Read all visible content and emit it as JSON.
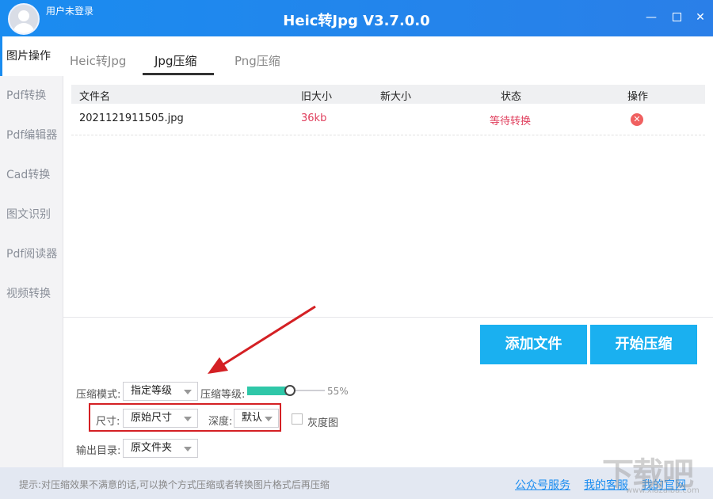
{
  "window": {
    "title": "Heic转Jpg V3.7.0.0",
    "user_label": "用户未登录",
    "minimize": "—",
    "close": "✕"
  },
  "sidebar": {
    "items": [
      {
        "label": "图片操作",
        "active": true
      },
      {
        "label": "Pdf转换"
      },
      {
        "label": "Pdf编辑器"
      },
      {
        "label": "Cad转换"
      },
      {
        "label": "图文识别"
      },
      {
        "label": "Pdf阅读器"
      },
      {
        "label": "视频转换"
      }
    ]
  },
  "tabs": [
    {
      "label": "Heic转Jpg"
    },
    {
      "label": "Jpg压缩",
      "active": true
    },
    {
      "label": "Png压缩"
    }
  ],
  "table": {
    "headers": [
      "文件名",
      "旧大小",
      "新大小",
      "状态",
      "操作"
    ],
    "rows": [
      {
        "filename": "2021121911505.jpg",
        "old_size": "36kb",
        "new_size": "",
        "status": "等待转换",
        "action_icon": "delete-icon"
      }
    ]
  },
  "buttons": {
    "add_files": "添加文件",
    "start_compress": "开始压缩"
  },
  "settings": {
    "mode_label": "压缩模式:",
    "mode_value": "指定等级",
    "level_label": "压缩等级:",
    "level_value": "55%",
    "level_fraction": 0.55,
    "size_label": "尺寸:",
    "size_value": "原始尺寸",
    "depth_label": "深度:",
    "depth_value": "默认",
    "grayscale_label": "灰度图",
    "output_label": "输出目录:",
    "output_value": "原文件夹"
  },
  "footer": {
    "tip": "提示:对压缩效果不满意的话,可以换个方式压缩或者转换图片格式后再压缩",
    "links": [
      "公众号服务",
      "我的客服",
      "我的官网"
    ]
  },
  "watermark": {
    "text": "下载吧",
    "sub": "www.xiazaiba.com"
  },
  "colors": {
    "accent": "#1a8cf0",
    "button": "#1ab0f0",
    "status_red": "#e0405e",
    "slider_fill": "#2fc7a8",
    "highlight_box": "#d42024"
  }
}
